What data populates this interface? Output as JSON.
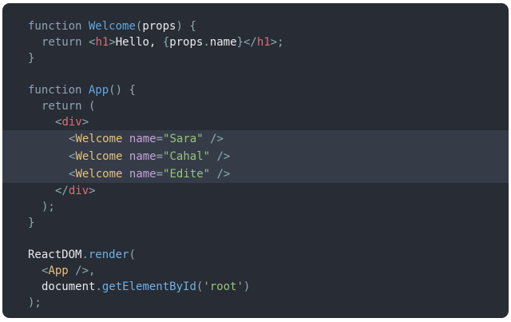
{
  "code": {
    "l1": {
      "kw": "function",
      "name": "Welcome",
      "open": "(",
      "param": "props",
      "close": ")",
      "brace": "{"
    },
    "l2": {
      "kw": "return",
      "lt": "<",
      "tag": "h1",
      "gt": ">",
      "text": "Hello, ",
      "expr_open": "{",
      "obj": "props",
      "dot": ".",
      "prop": "name",
      "expr_close": "}",
      "close_open": "</",
      "close_tag": "h1",
      "close_gt": ">",
      "semi": ";"
    },
    "l3": {
      "brace": "}"
    },
    "l5": {
      "kw": "function",
      "name": "App",
      "parens": "()",
      "brace": "{"
    },
    "l6": {
      "kw": "return",
      "paren": "("
    },
    "l7": {
      "lt": "<",
      "tag": "div",
      "gt": ">"
    },
    "welcome_lines": [
      {
        "lt": "<",
        "comp": "Welcome",
        "attr": "name",
        "eq": "=",
        "value": "\"Sara\"",
        "end": "/>"
      },
      {
        "lt": "<",
        "comp": "Welcome",
        "attr": "name",
        "eq": "=",
        "value": "\"Cahal\"",
        "end": "/>"
      },
      {
        "lt": "<",
        "comp": "Welcome",
        "attr": "name",
        "eq": "=",
        "value": "\"Edite\"",
        "end": "/>"
      }
    ],
    "l11": {
      "open": "</",
      "tag": "div",
      "gt": ">"
    },
    "l12": {
      "text": ");"
    },
    "l13": {
      "brace": "}"
    },
    "l15": {
      "obj": "ReactDOM",
      "dot": ".",
      "method": "render",
      "paren": "("
    },
    "l16": {
      "lt": "<",
      "comp": "App",
      "end": "/>",
      "comma": ","
    },
    "l17": {
      "obj": "document",
      "dot": ".",
      "method": "getElementById",
      "open": "(",
      "arg": "'root'",
      "close": ")"
    },
    "l18": {
      "text": ");"
    }
  },
  "colors": {
    "background": "#282c34",
    "highlight": "#353c48",
    "keyword": "#8fa2b5",
    "function": "#5fa8e0",
    "tag": "#e06c75",
    "component": "#e5c07b",
    "attribute": "#c6a2d8",
    "string": "#98c379"
  }
}
